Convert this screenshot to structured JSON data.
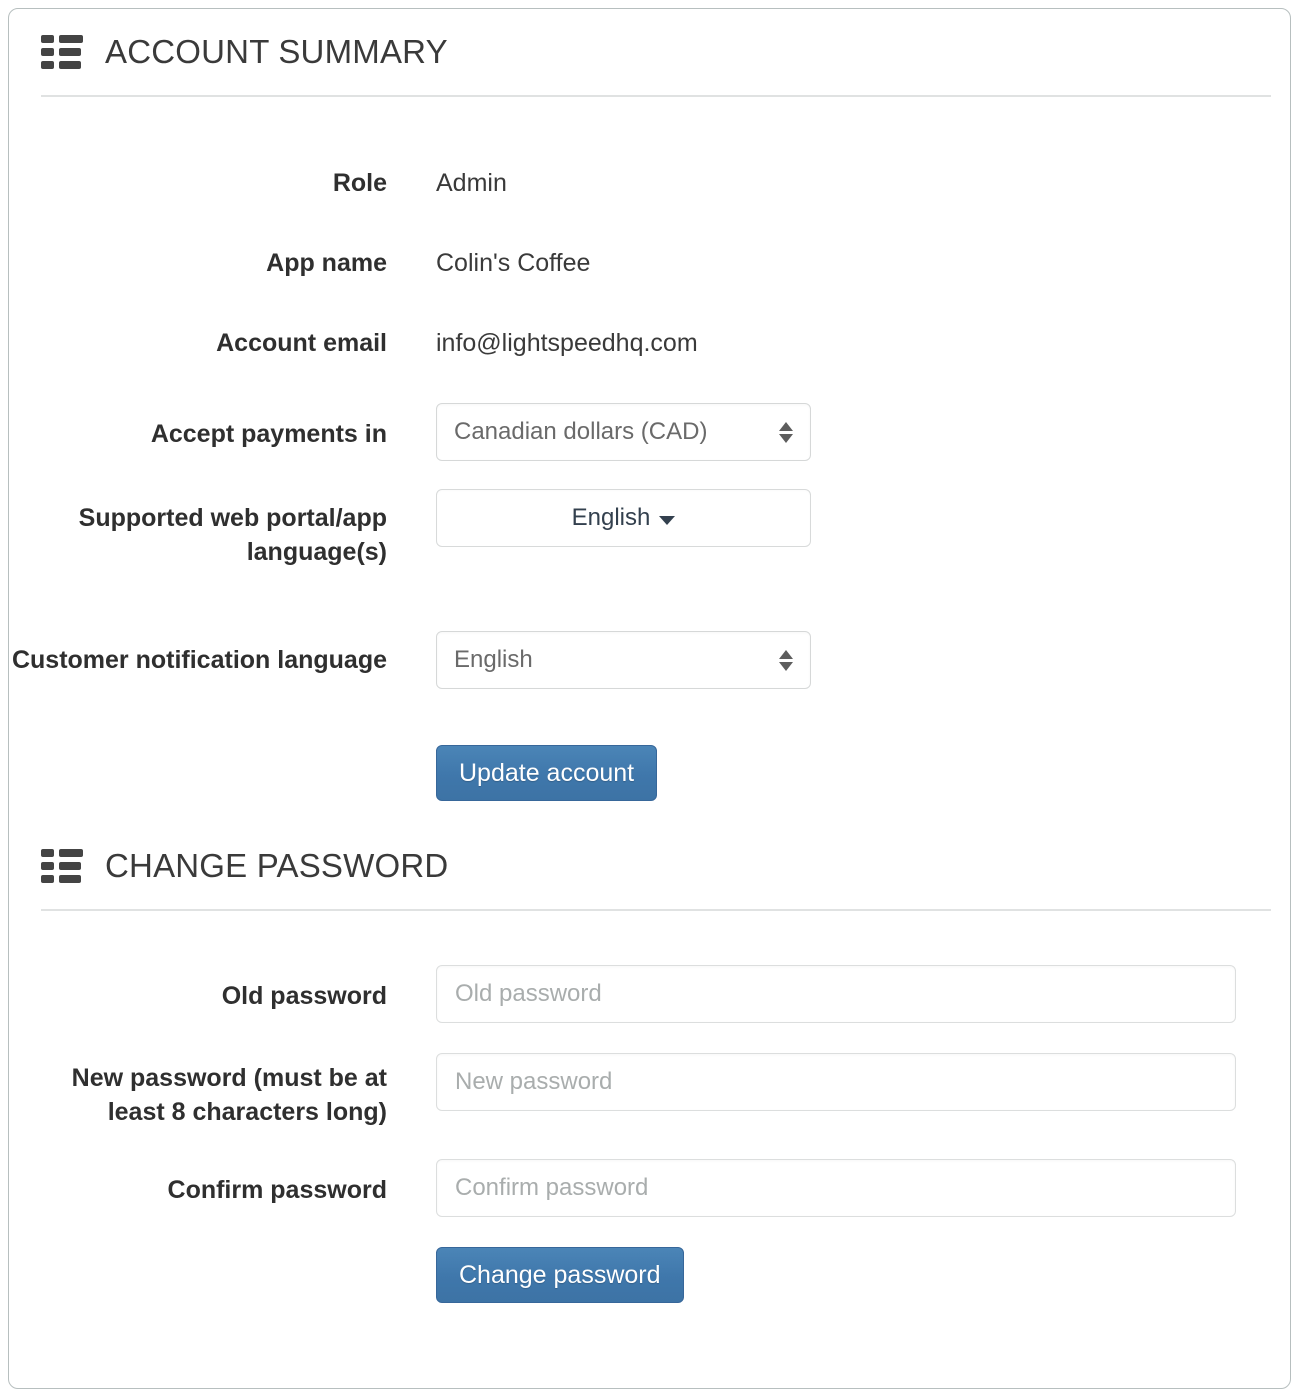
{
  "account_summary": {
    "icon": "list-icon",
    "title": "ACCOUNT SUMMARY",
    "fields": {
      "role": {
        "label": "Role",
        "value": "Admin"
      },
      "app_name": {
        "label": "App name",
        "value": "Colin's Coffee"
      },
      "account_email": {
        "label": "Account email",
        "value": "info@lightspeedhq.com"
      },
      "currency": {
        "label": "Accept payments in",
        "value": "Canadian dollars (CAD)"
      },
      "portal_languages": {
        "label": "Supported web portal/app language(s)",
        "value": "English"
      },
      "notification_language": {
        "label": "Customer notification language",
        "value": "English"
      }
    },
    "update_button": "Update account"
  },
  "change_password": {
    "icon": "list-icon",
    "title": "CHANGE PASSWORD",
    "fields": {
      "old_password": {
        "label": "Old password",
        "placeholder": "Old password",
        "value": ""
      },
      "new_password": {
        "label": "New password (must be at least 8 characters long)",
        "placeholder": "New password",
        "value": ""
      },
      "confirm_password": {
        "label": "Confirm password",
        "placeholder": "Confirm password",
        "value": ""
      }
    },
    "change_button": "Change password"
  },
  "colors": {
    "primary_button": "#3f77ab",
    "heading_text": "#3a3a3a",
    "label_text": "#2f2f2f",
    "border": "#d8dada",
    "divider": "#e0e2e2",
    "placeholder": "#a9adad",
    "card_border": "#b7bfbf"
  }
}
